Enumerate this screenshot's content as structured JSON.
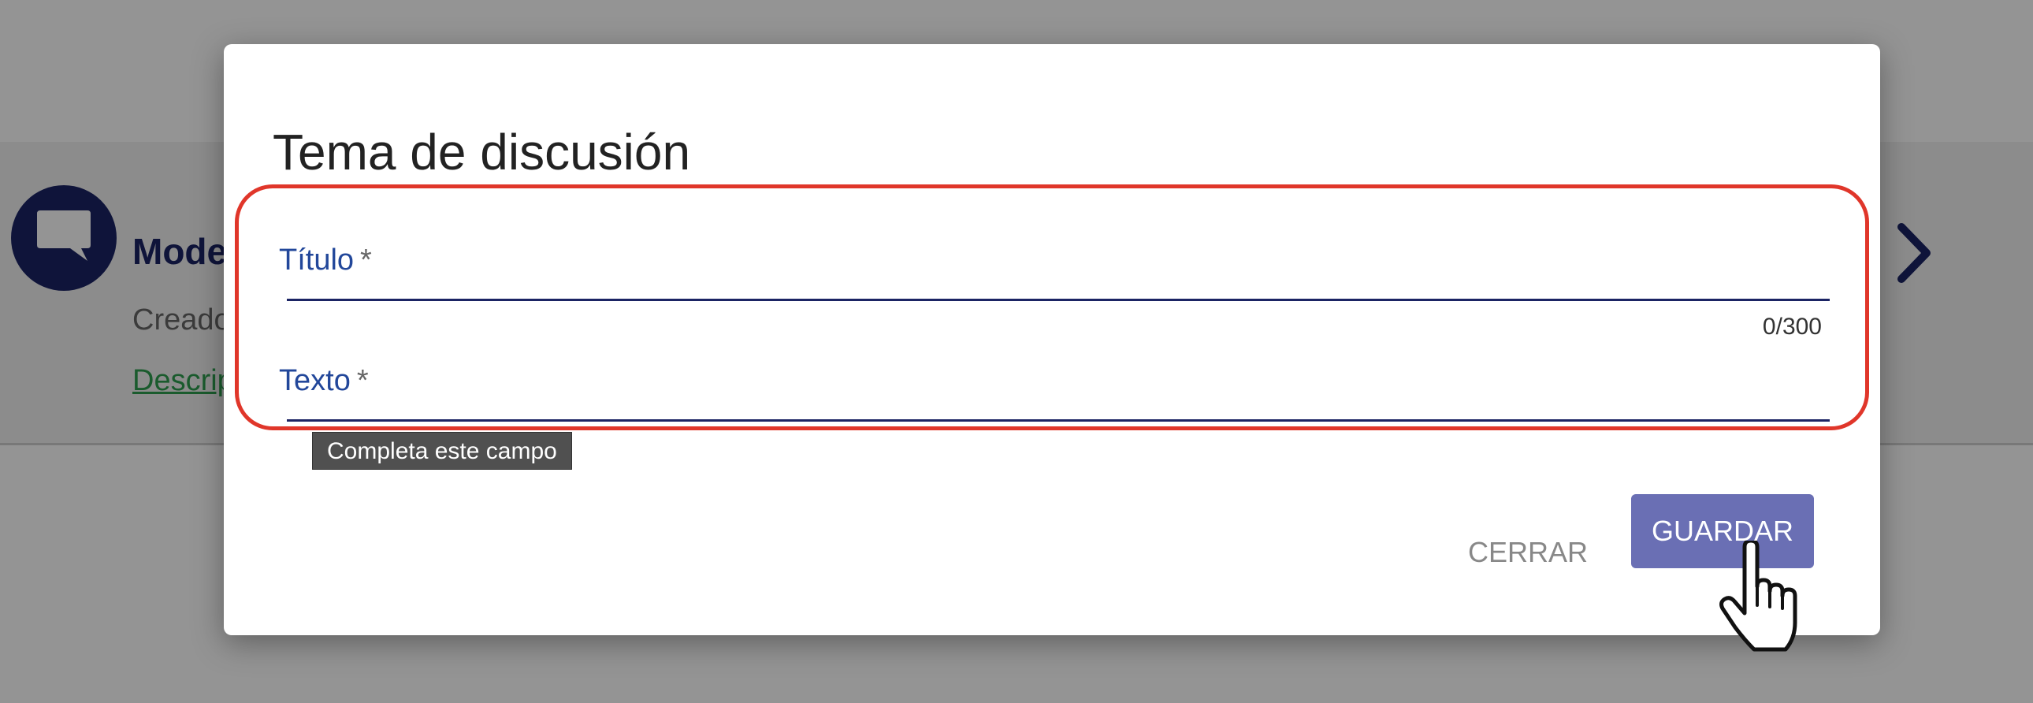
{
  "background": {
    "card_title": "Mode",
    "card_subtitle": "Creado",
    "card_link": "Descrip"
  },
  "dialog": {
    "title": "Tema de discusión",
    "fields": [
      {
        "label": "Título",
        "required_mark": "*",
        "value": "",
        "counter": "0/300"
      },
      {
        "label": "Texto",
        "required_mark": "*",
        "value": ""
      }
    ],
    "tooltip": "Completa este campo",
    "buttons": {
      "close": "CERRAR",
      "save": "GUARDAR"
    }
  },
  "colors": {
    "primary": "#1b2464",
    "label_blue": "#22479a",
    "save_button": "#6a6fb4",
    "highlight_red": "#e0362a",
    "link_green": "#2e9e4f"
  },
  "icons": [
    "chat-bubble-icon",
    "chevron-right-icon",
    "hand-pointer-icon"
  ]
}
